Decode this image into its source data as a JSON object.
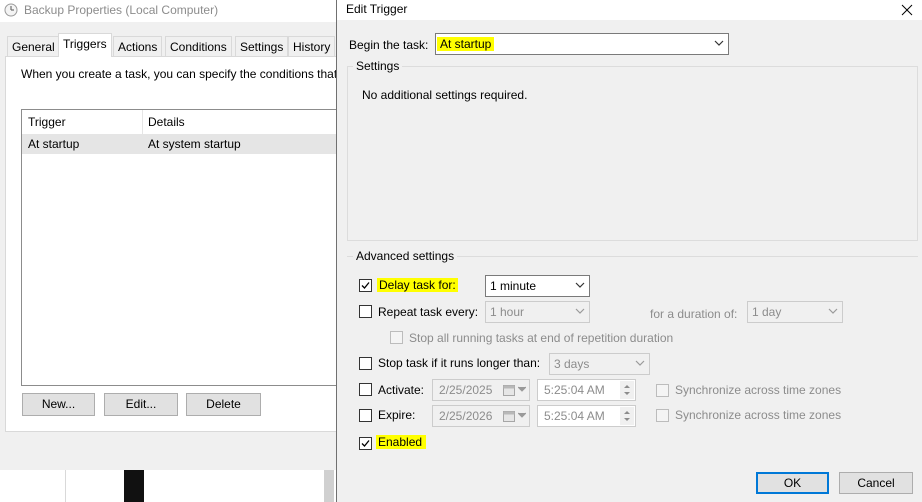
{
  "background_window": {
    "title": "Backup Properties (Local Computer)",
    "tabs": [
      "General",
      "Triggers",
      "Actions",
      "Conditions",
      "Settings",
      "History"
    ],
    "selected_tab": "Triggers",
    "description": "When you create a task, you can specify the conditions that",
    "list": {
      "headers": [
        "Trigger",
        "Details"
      ],
      "rows": [
        {
          "trigger": "At startup",
          "details": "At system startup"
        }
      ]
    },
    "buttons": {
      "new": "New...",
      "edit": "Edit...",
      "delete": "Delete"
    }
  },
  "dialog": {
    "title": "Edit Trigger",
    "begin_label": "Begin the task:",
    "begin_value": "At startup",
    "settings": {
      "label": "Settings",
      "message": "No additional settings required."
    },
    "advanced": {
      "label": "Advanced settings",
      "delay": {
        "label": "Delay task for:",
        "checked": true,
        "value": "1 minute"
      },
      "repeat": {
        "label": "Repeat task every:",
        "checked": false,
        "value": "1 hour",
        "duration_label": "for a duration of:",
        "duration_value": "1 day"
      },
      "stop_running": {
        "label": "Stop all running tasks at end of repetition duration",
        "checked": false
      },
      "stop_longer": {
        "label": "Stop task if it runs longer than:",
        "checked": false,
        "value": "3 days"
      },
      "activate": {
        "label": "Activate:",
        "checked": false,
        "date": "2/25/2025",
        "time": "5:25:04 AM",
        "sync_label": "Synchronize across time zones"
      },
      "expire": {
        "label": "Expire:",
        "checked": false,
        "date": "2/25/2026",
        "time": "5:25:04 AM",
        "sync_label": "Synchronize across time zones"
      },
      "enabled": {
        "label": "Enabled",
        "checked": true
      }
    },
    "buttons": {
      "ok": "OK",
      "cancel": "Cancel"
    }
  },
  "colors": {
    "highlight": "#ffff00",
    "accent": "#0078d7"
  }
}
